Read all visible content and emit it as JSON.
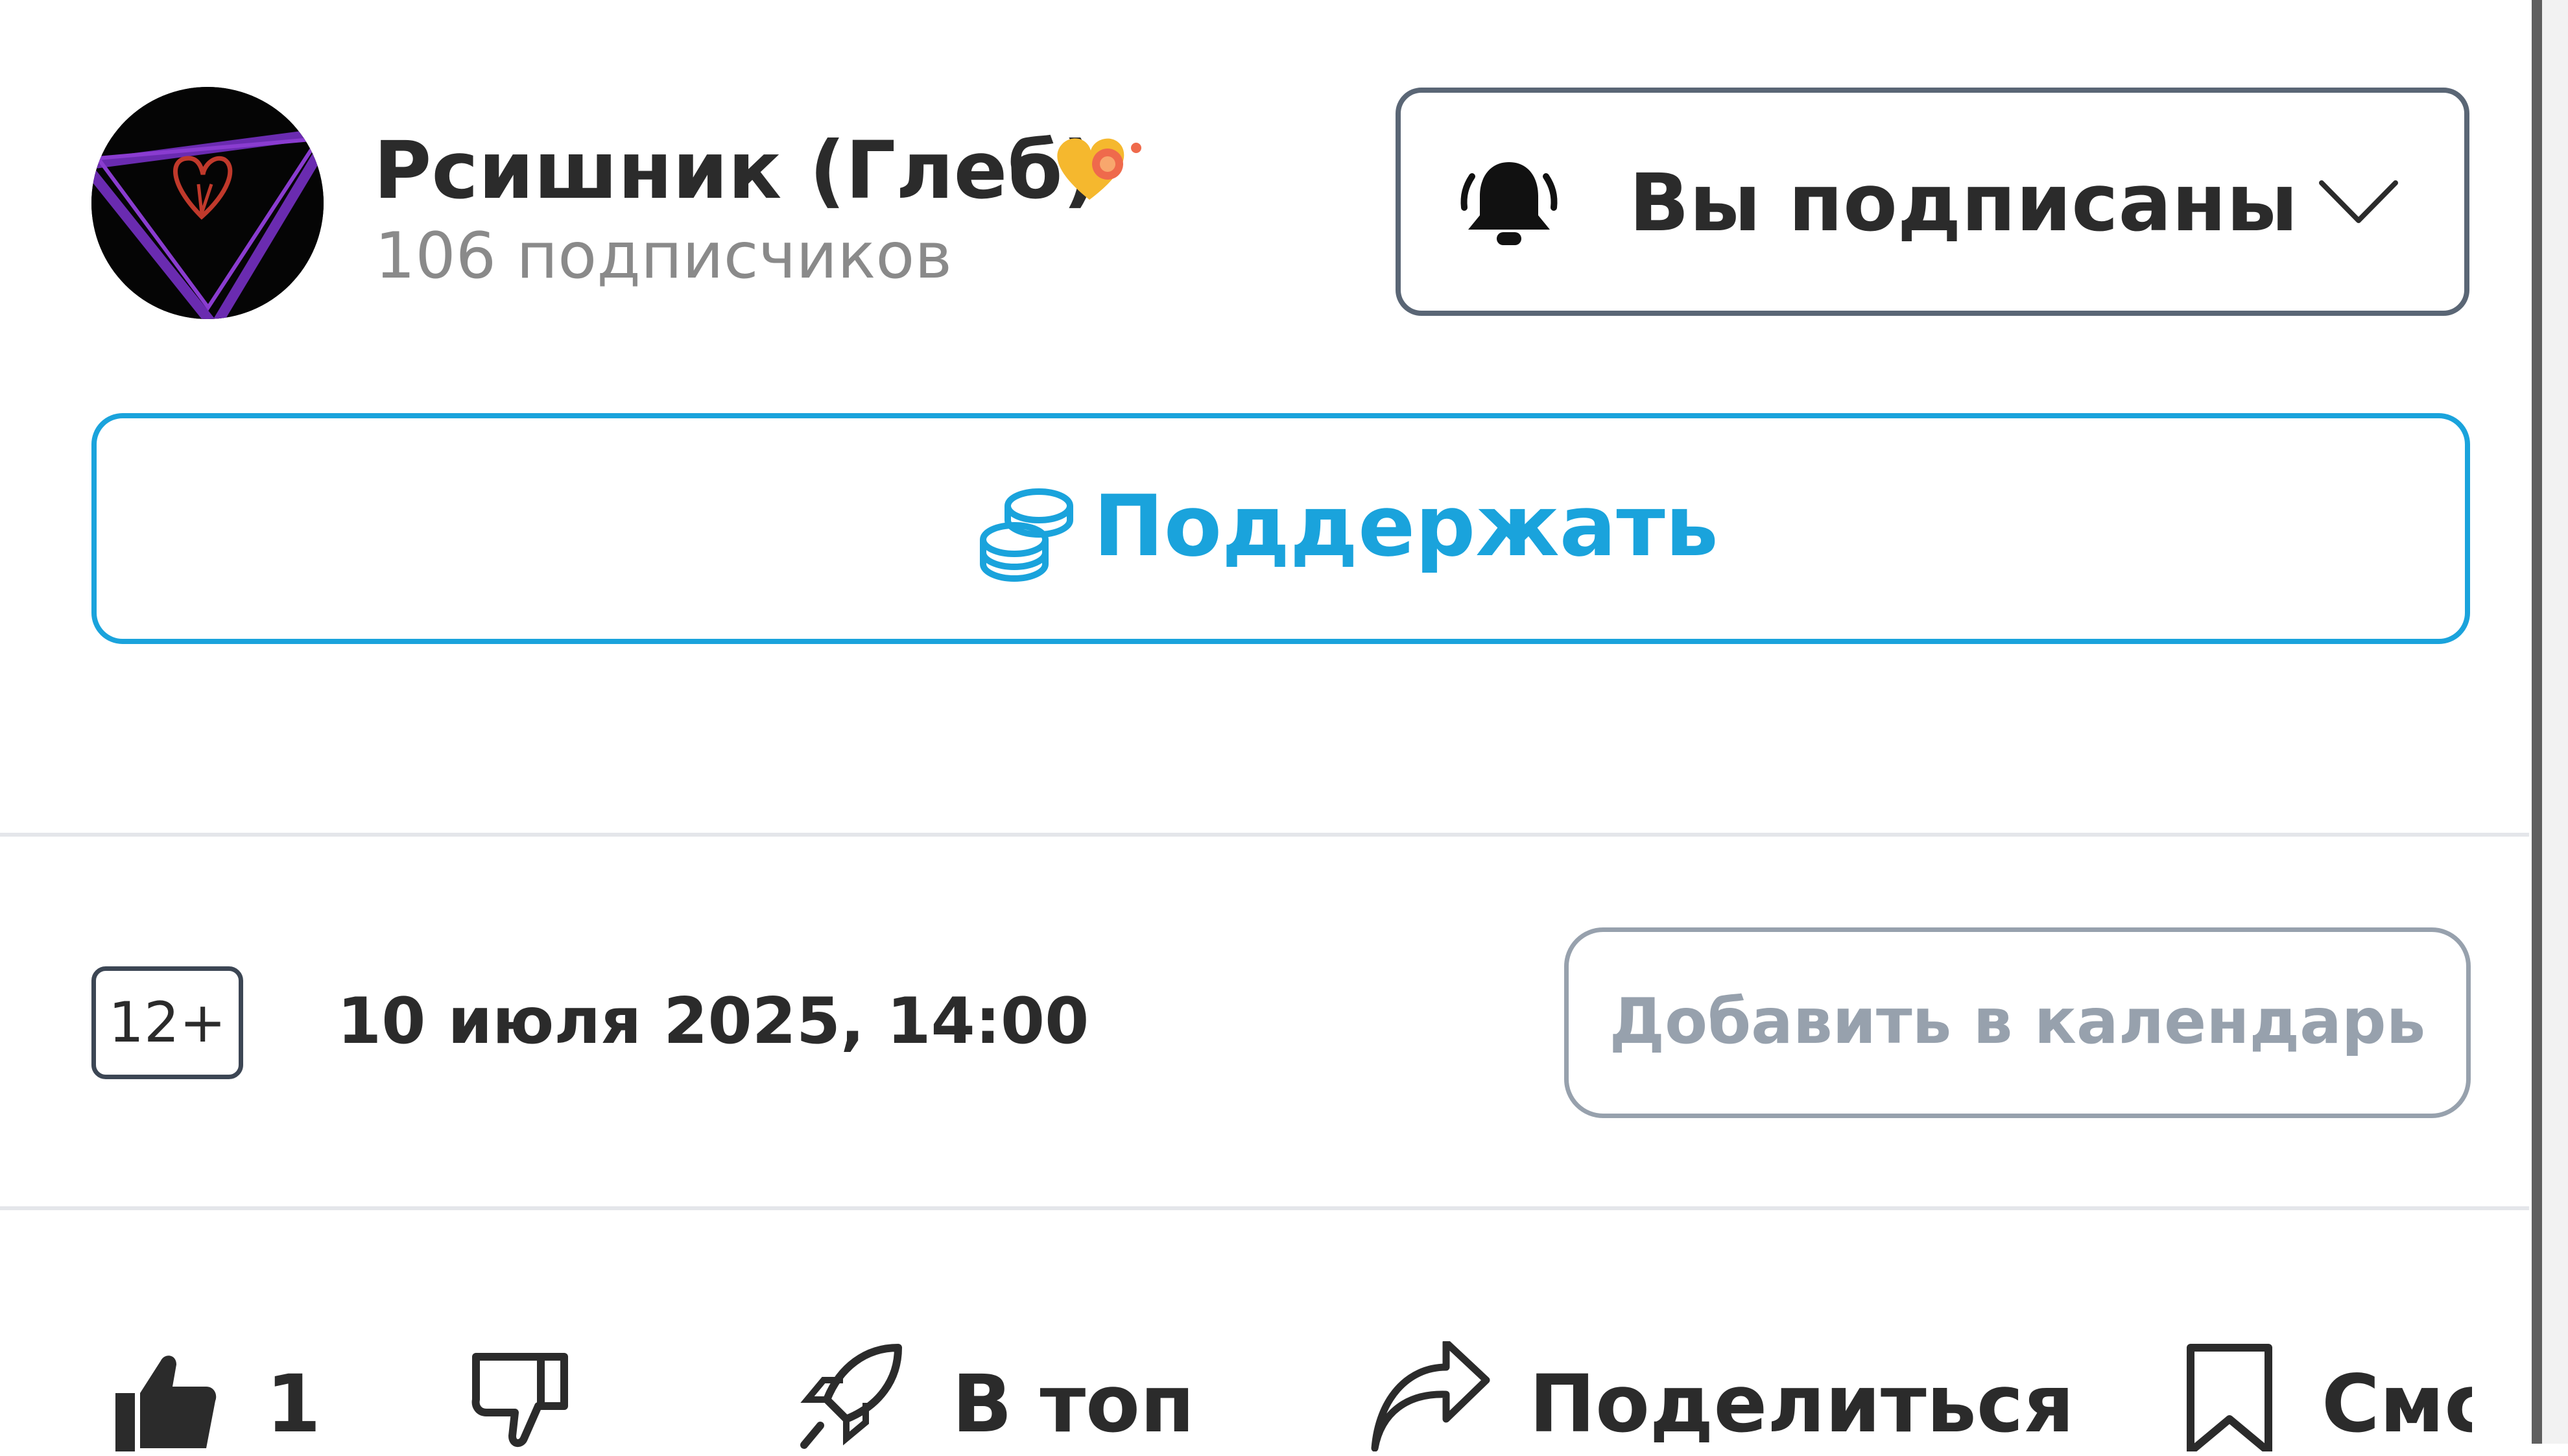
{
  "author": {
    "name": "Рсишник (Глеб)",
    "followers": "106 подписчиков"
  },
  "subscribe": {
    "label": "Вы подписаны"
  },
  "support": {
    "label": "Поддержать"
  },
  "event": {
    "age_rating": "12+",
    "date": "10 июля 2025, 14:00",
    "calendar_label": "Добавить в календарь"
  },
  "actions": {
    "likes": "1",
    "boost_label": "В топ",
    "share_label": "Поделиться",
    "save_label": "Смс"
  },
  "colors": {
    "accent": "#1aa3dc",
    "text": "#2b2b2b",
    "muted": "#8a8a8a",
    "border": "#5a6675",
    "calendar": "#97a1ad"
  },
  "icons": [
    "bell-icon",
    "chevron-down-icon",
    "coins-icon",
    "heart-badge-icon",
    "thumbs-up-icon",
    "thumbs-down-icon",
    "rocket-icon",
    "share-icon",
    "bookmark-icon"
  ]
}
